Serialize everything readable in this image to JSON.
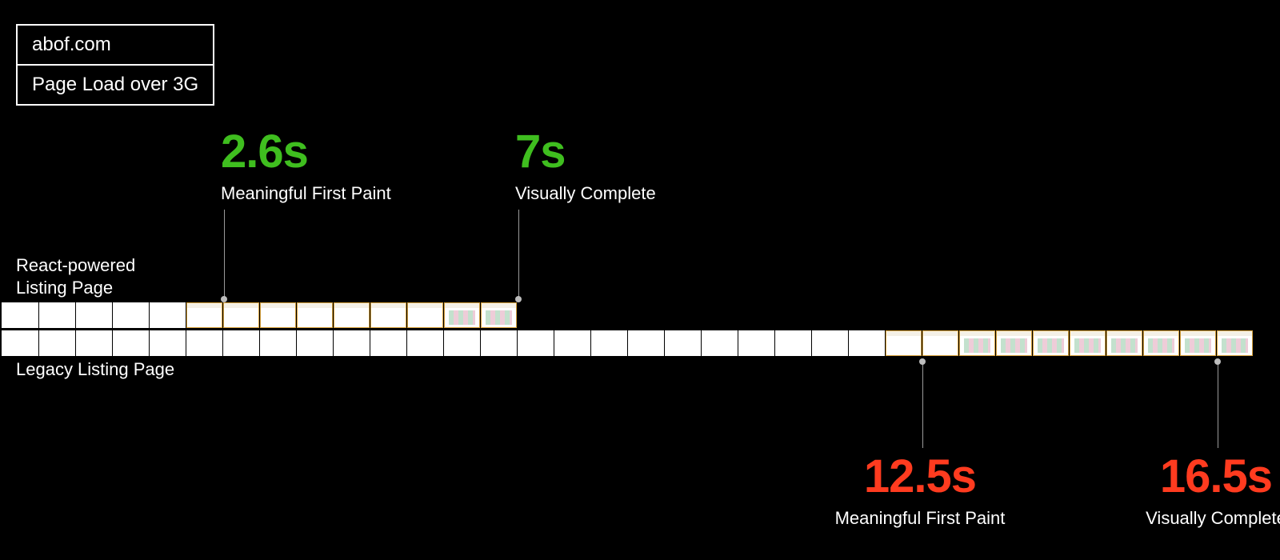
{
  "title": {
    "site": "abof.com",
    "context": "Page Load over 3G"
  },
  "rows": {
    "react": {
      "label_line1": "React-powered",
      "label_line2": "Listing Page"
    },
    "legacy": {
      "label": "Legacy Listing Page"
    }
  },
  "metrics": {
    "react_mfp": {
      "value": "2.6s",
      "label": "Meaningful First Paint"
    },
    "react_vc": {
      "value": "7s",
      "label": "Visually Complete"
    },
    "legacy_mfp": {
      "value": "12.5s",
      "label": "Meaningful First Paint"
    },
    "legacy_vc": {
      "value": "16.5s",
      "label": "Visually Complete"
    }
  },
  "chart_data": {
    "type": "timeline-filmstrip",
    "title": "abof.com Page Load over 3G",
    "unit": "seconds",
    "frame_interval_s": 0.5,
    "frame_count": 34,
    "tracks": [
      {
        "name": "React-powered Listing Page",
        "meaningful_first_paint_s": 2.6,
        "visually_complete_s": 7.0,
        "blank_until_frame": 5,
        "partial_from_frame": 6,
        "complete_from_frame": 13,
        "ends_at_frame": 14
      },
      {
        "name": "Legacy Listing Page",
        "meaningful_first_paint_s": 12.5,
        "visually_complete_s": 16.5,
        "blank_until_frame": 24,
        "partial_from_frame": 25,
        "complete_from_frame": 27,
        "ends_at_frame": 34
      }
    ],
    "colors": {
      "react": "#3fbe1f",
      "legacy": "#ff3b1f",
      "background": "#000000"
    }
  }
}
